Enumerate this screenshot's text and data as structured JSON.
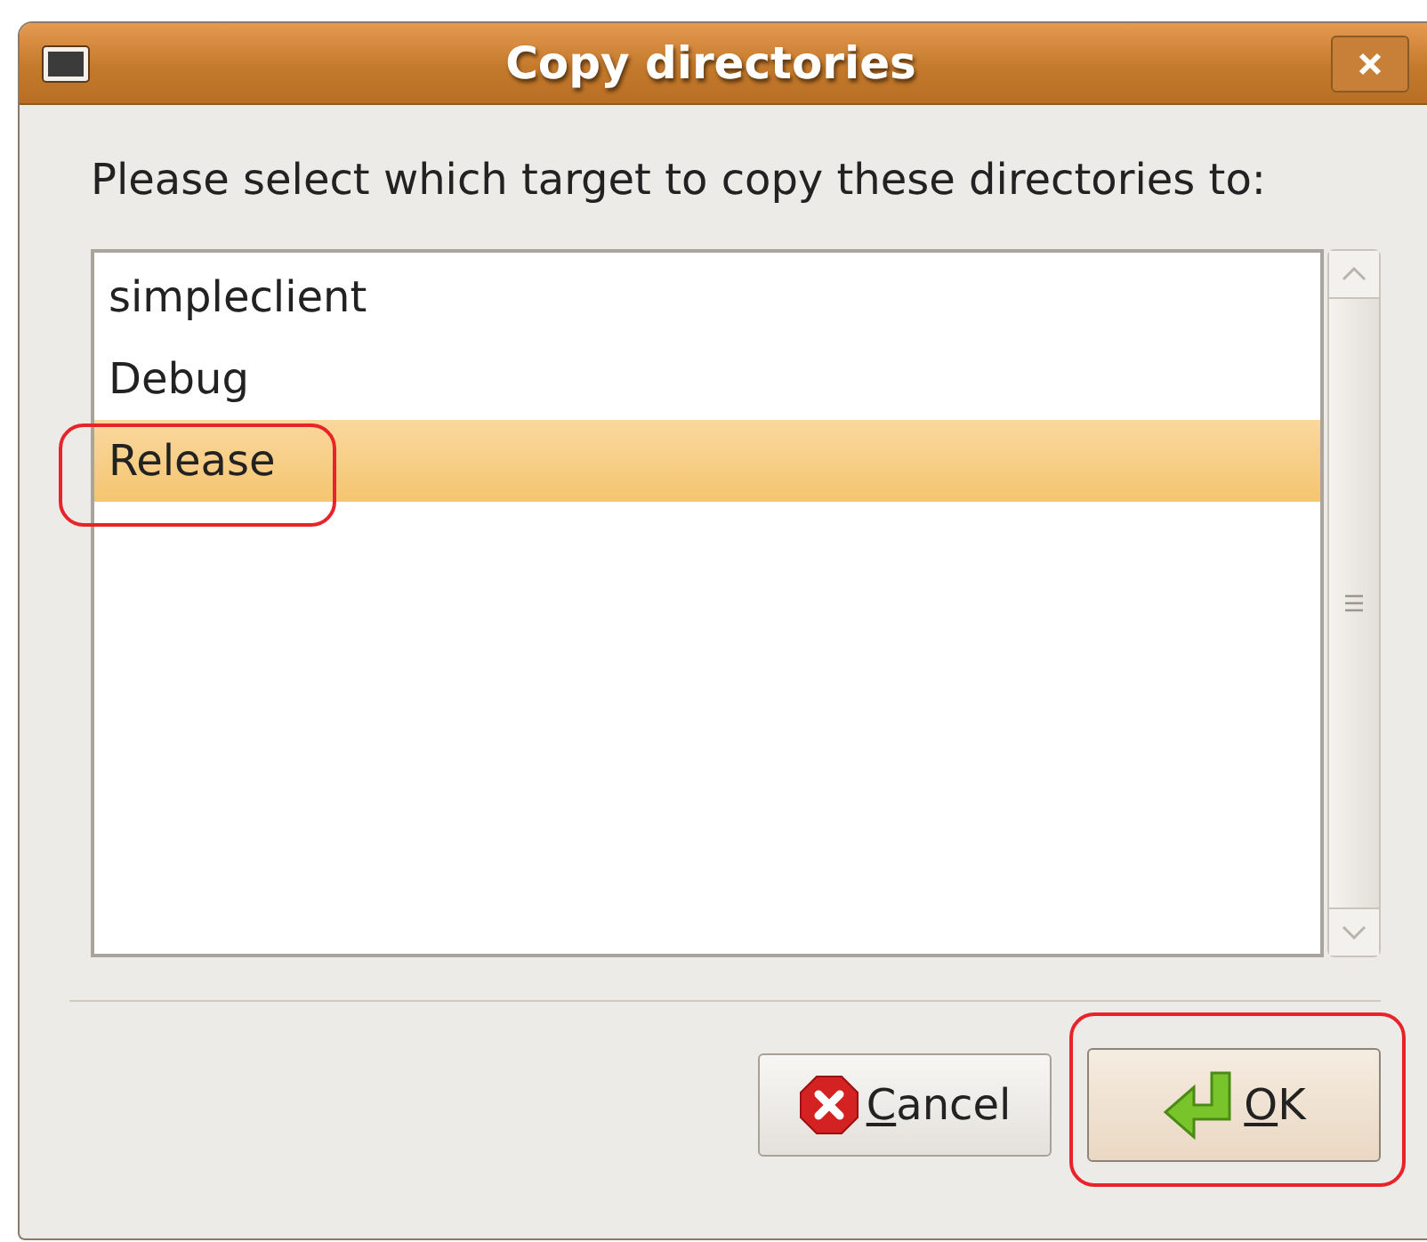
{
  "window": {
    "title": "Copy directories"
  },
  "prompt": "Please select which target to copy these directories to:",
  "list": {
    "items": [
      {
        "label": "simpleclient",
        "selected": false,
        "annotated": false
      },
      {
        "label": "Debug",
        "selected": false,
        "annotated": false
      },
      {
        "label": "Release",
        "selected": true,
        "annotated": true
      }
    ]
  },
  "buttons": [
    {
      "label": "Cancel",
      "kind": "cancel",
      "underline_first": true,
      "focused": false,
      "annotated": false
    },
    {
      "label": "OK",
      "kind": "ok",
      "underline_first": true,
      "focused": true,
      "annotated": true
    }
  ]
}
